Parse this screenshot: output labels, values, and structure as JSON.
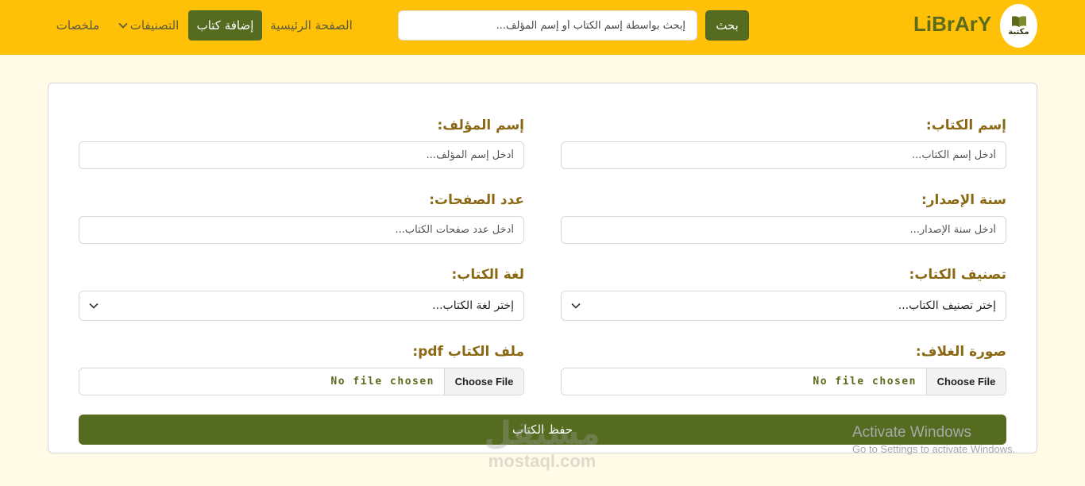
{
  "header": {
    "logo_text": "مكتبة",
    "brand": "LiBrArY",
    "search_button": "بحث",
    "search_placeholder": "إبحث بواسطة إسم الكتاب أو إسم المؤلف...",
    "nav": {
      "home": "الصفحة الرئيسية",
      "add_book": "إضافة كتاب",
      "categories": "التصنيفات",
      "summaries": "ملخصات"
    },
    "colors": {
      "bar": "#ffc107",
      "accent": "#556b1f"
    }
  },
  "form": {
    "book_name": {
      "label": "إسم الكتاب:",
      "placeholder": "أدخل إسم الكتاب..."
    },
    "author_name": {
      "label": "إسم المؤلف:",
      "placeholder": "أدخل إسم المؤلف..."
    },
    "release_year": {
      "label": "سنة الإصدار:",
      "placeholder": "أدخل سنة الإصدار..."
    },
    "page_count": {
      "label": "عدد الصفحات:",
      "placeholder": "أدخل عدد صفحات الكتاب..."
    },
    "category": {
      "label": "تصنيف الكتاب:",
      "selected": "إختر تصنيف الكتاب..."
    },
    "language": {
      "label": "لغة الكتاب:",
      "selected": "إختر لغة الكتاب..."
    },
    "cover_image": {
      "label": "صورة الغلاف:",
      "button": "Choose File",
      "status": "No file chosen"
    },
    "pdf_file": {
      "label": "ملف الكتاب pdf:",
      "button": "Choose File",
      "status": "No file chosen"
    },
    "save_button": "حفظ الكتاب"
  },
  "overlay": {
    "activate_title": "Activate Windows",
    "activate_sub": "Go to Settings to activate Windows.",
    "watermark_ar": "مستقل",
    "watermark_en": "mostaql.com"
  }
}
